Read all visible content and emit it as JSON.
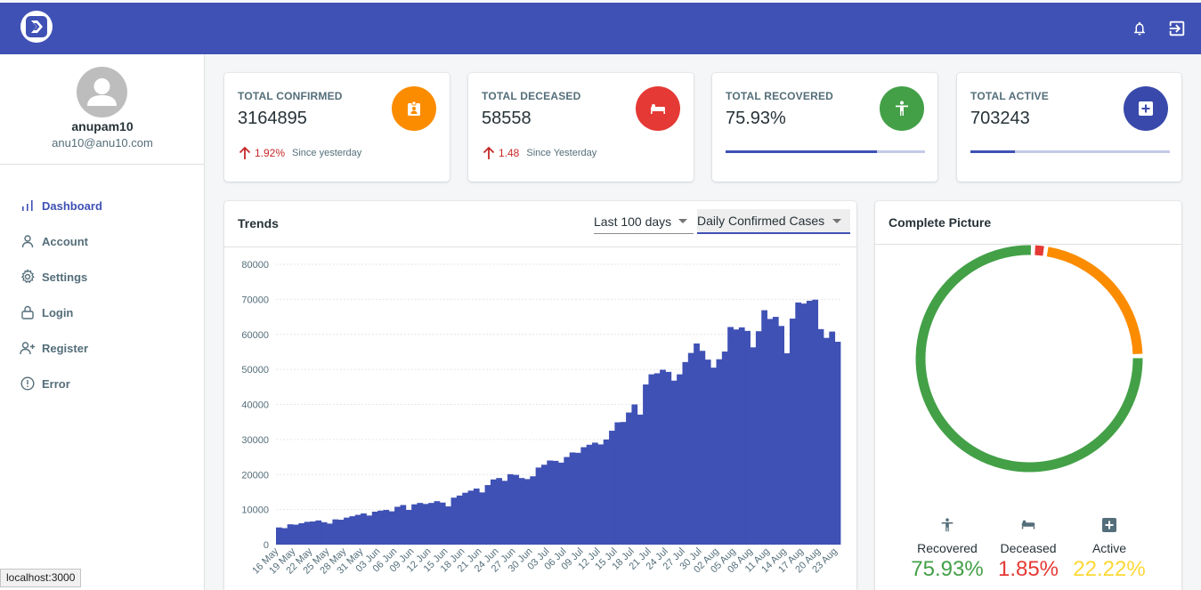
{
  "header": {
    "logo_icon": "logo-chevron-icon",
    "icons": [
      "bell-icon",
      "logout-icon"
    ]
  },
  "user": {
    "name": "anupam10",
    "email": "anu10@anu10.com"
  },
  "nav": [
    {
      "label": "Dashboard",
      "icon": "bar-chart-icon",
      "active": true
    },
    {
      "label": "Account",
      "icon": "user-icon"
    },
    {
      "label": "Settings",
      "icon": "gear-icon"
    },
    {
      "label": "Login",
      "icon": "lock-icon"
    },
    {
      "label": "Register",
      "icon": "user-plus-icon"
    },
    {
      "label": "Error",
      "icon": "alert-circle-icon"
    }
  ],
  "stats": {
    "confirmed": {
      "title": "TOTAL CONFIRMED",
      "value": "3164895",
      "diff": "1.92%",
      "since": "Since yesterday",
      "color": "#fb8c00"
    },
    "deceased": {
      "title": "TOTAL DECEASED",
      "value": "58558",
      "diff": "1.48",
      "since": "Since Yesterday",
      "color": "#e53935"
    },
    "recovered": {
      "title": "TOTAL RECOVERED",
      "value": "75.93%",
      "progress": 0.7593,
      "color": "#43a047"
    },
    "active": {
      "title": "TOTAL ACTIVE",
      "value": "703243",
      "progress": 0.2222,
      "color": "#3949ab"
    }
  },
  "trends": {
    "title": "Trends",
    "range_select": "Last 100 days",
    "metric_select": "Daily Confirmed Cases"
  },
  "chart_data": [
    {
      "type": "bar",
      "ylim": [
        0,
        80000
      ],
      "yticks": [
        "0",
        "10000",
        "20000",
        "30000",
        "40000",
        "50000",
        "60000",
        "70000",
        "80000"
      ],
      "xticks": [
        "16 May",
        "19 May",
        "22 May",
        "25 May",
        "28 May",
        "31 May",
        "03 Jun",
        "06 Jun",
        "09 Jun",
        "12 Jun",
        "15 Jun",
        "18 Jun",
        "21 Jun",
        "24 Jun",
        "27 Jun",
        "30 Jun",
        "03 Jul",
        "06 Jul",
        "09 Jul",
        "12 Jul",
        "15 Jul",
        "18 Jul",
        "21 Jul",
        "24 Jul",
        "27 Jul",
        "30 Jul",
        "02 Aug",
        "05 Aug",
        "08 Aug",
        "11 Aug",
        "14 Aug",
        "17 Aug",
        "20 Aug",
        "23 Aug"
      ],
      "values": [
        4900,
        4700,
        5800,
        5700,
        6100,
        6500,
        6600,
        6900,
        6400,
        6000,
        7200,
        7100,
        7700,
        8100,
        8500,
        8900,
        8300,
        9400,
        9700,
        9900,
        9500,
        10800,
        11300,
        9900,
        11500,
        11900,
        11600,
        11900,
        12400,
        12000,
        10900,
        13400,
        14000,
        14800,
        15400,
        16000,
        14900,
        17000,
        18600,
        19000,
        18200,
        20100,
        19900,
        19000,
        18700,
        19500,
        22000,
        22800,
        24000,
        23900,
        23400,
        25000,
        26300,
        26200,
        27800,
        28500,
        29100,
        28600,
        30000,
        32500,
        34900,
        35000,
        37700,
        40000,
        37100,
        45700,
        48600,
        48900,
        49900,
        49300,
        46800,
        48600,
        52100,
        54700,
        57400,
        55300,
        52800,
        50500,
        52900,
        55100,
        62100,
        61400,
        62000,
        61000,
        56300,
        60900,
        66900,
        64400,
        65000,
        62400,
        54600,
        64500,
        69100,
        68800,
        69600,
        69900,
        61500,
        59000,
        60800,
        57900
      ]
    },
    {
      "type": "pie",
      "title": "Complete Picture",
      "categories": [
        "Recovered",
        "Deceased",
        "Active"
      ],
      "values": [
        75.93,
        1.85,
        22.22
      ],
      "colors": [
        "#43a047",
        "#e53935",
        "#fb8c00"
      ]
    }
  ],
  "picture": {
    "title": "Complete Picture",
    "items": [
      {
        "label": "Recovered",
        "value": "75.93%",
        "color": "#43a047",
        "icon": "person-icon"
      },
      {
        "label": "Deceased",
        "value": "1.85%",
        "color": "#e53935",
        "icon": "bed-icon"
      },
      {
        "label": "Active",
        "value": "22.22%",
        "color": "#fdd835",
        "icon": "plus-box-icon"
      }
    ]
  },
  "status_bar": "localhost:3000"
}
